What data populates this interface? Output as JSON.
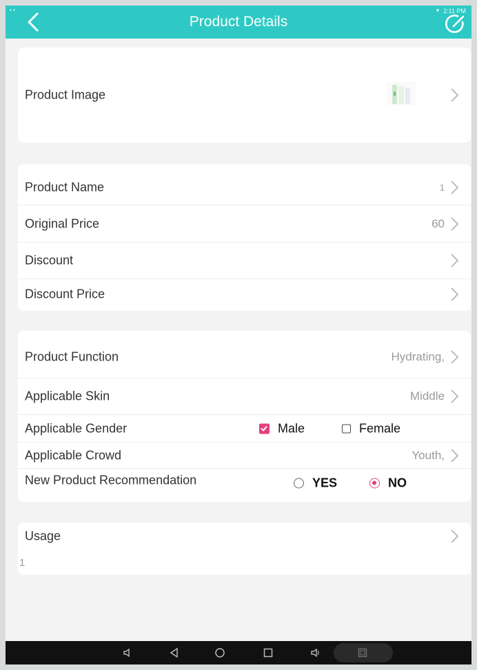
{
  "app": {
    "title": "Product Details",
    "status_time": "2:11 PM"
  },
  "colors": {
    "header": "#2ec9c4",
    "accent": "#e6407f",
    "background": "#f3f3f3"
  },
  "product_image": {
    "label": "Product Image"
  },
  "basic": {
    "name_label": "Product Name",
    "name_value": "1",
    "original_price_label": "Original Price",
    "original_price_value": "60",
    "discount_label": "Discount",
    "discount_value": "",
    "discount_price_label": "Discount Price",
    "discount_price_value": ""
  },
  "attributes": {
    "function_label": "Product Function",
    "function_value": "Hydrating,",
    "skin_label": "Applicable Skin",
    "skin_value": "Middle",
    "gender_label": "Applicable Gender",
    "gender_options": [
      {
        "label": "Male",
        "checked": true
      },
      {
        "label": "Female",
        "checked": false
      }
    ],
    "crowd_label": "Applicable Crowd",
    "crowd_value": "Youth,",
    "recommend_label": "New Product Recommendation",
    "recommend_options": [
      {
        "label": "YES",
        "selected": false
      },
      {
        "label": "NO",
        "selected": true
      }
    ]
  },
  "usage": {
    "label": "Usage",
    "text": "1"
  },
  "icons": {
    "back": "back-arrow-icon",
    "edit": "edit-icon",
    "chevron": "chevron-right-icon"
  }
}
